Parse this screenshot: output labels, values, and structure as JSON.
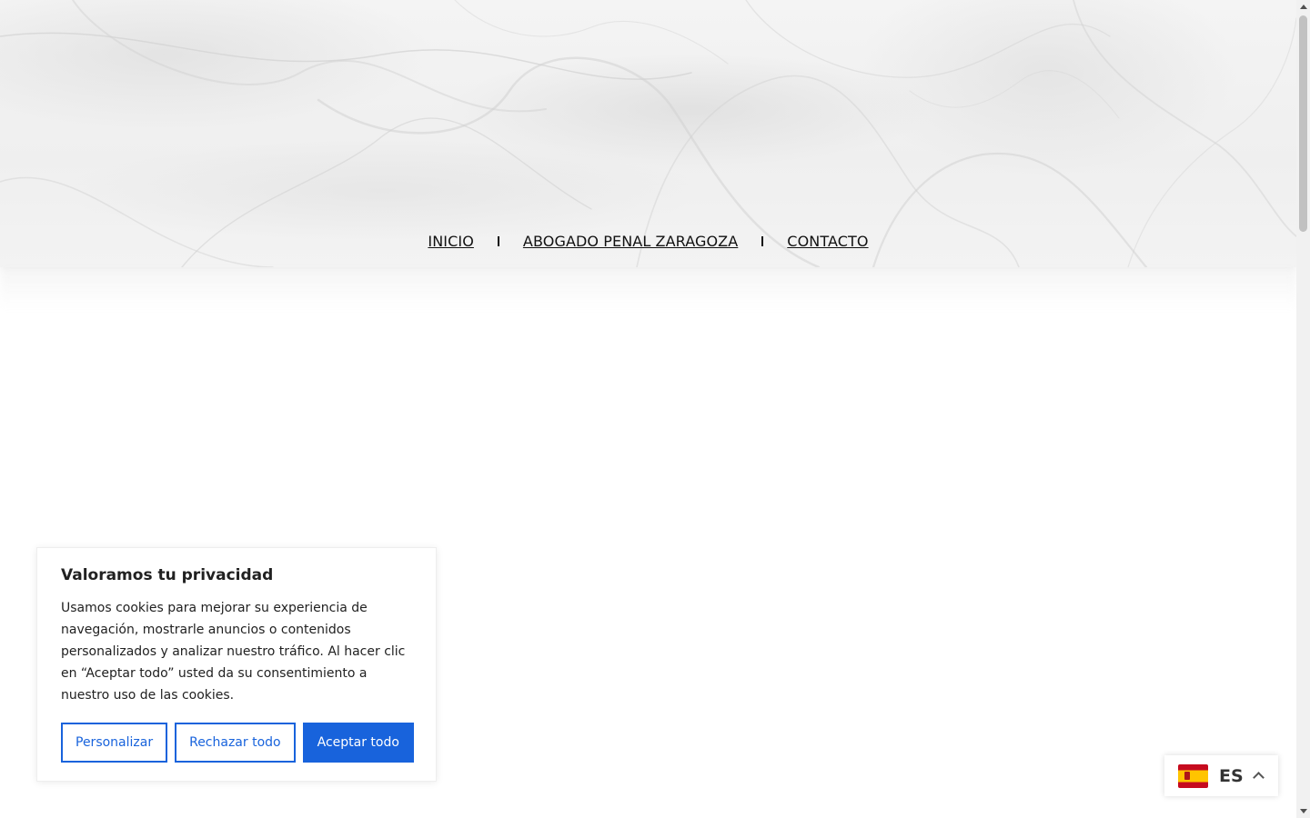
{
  "nav": {
    "items": [
      {
        "label": "INICIO"
      },
      {
        "label": "ABOGADO PENAL ZARAGOZA"
      },
      {
        "label": "CONTACTO"
      }
    ]
  },
  "cookie_banner": {
    "title": "Valoramos tu privacidad",
    "text": "Usamos cookies para mejorar su experiencia de navegación, mostrarle anuncios o contenidos personalizados y analizar nuestro tráfico. Al hacer clic en “Aceptar todo” usted da su consentimiento a nuestro uso de las cookies.",
    "customize_label": "Personalizar",
    "reject_label": "Rechazar todo",
    "accept_label": "Aceptar todo",
    "accent_color": "#1863dc"
  },
  "language_switcher": {
    "code": "ES",
    "flag_icon": "spain-flag-icon",
    "chevron_icon": "chevron-up-icon"
  }
}
